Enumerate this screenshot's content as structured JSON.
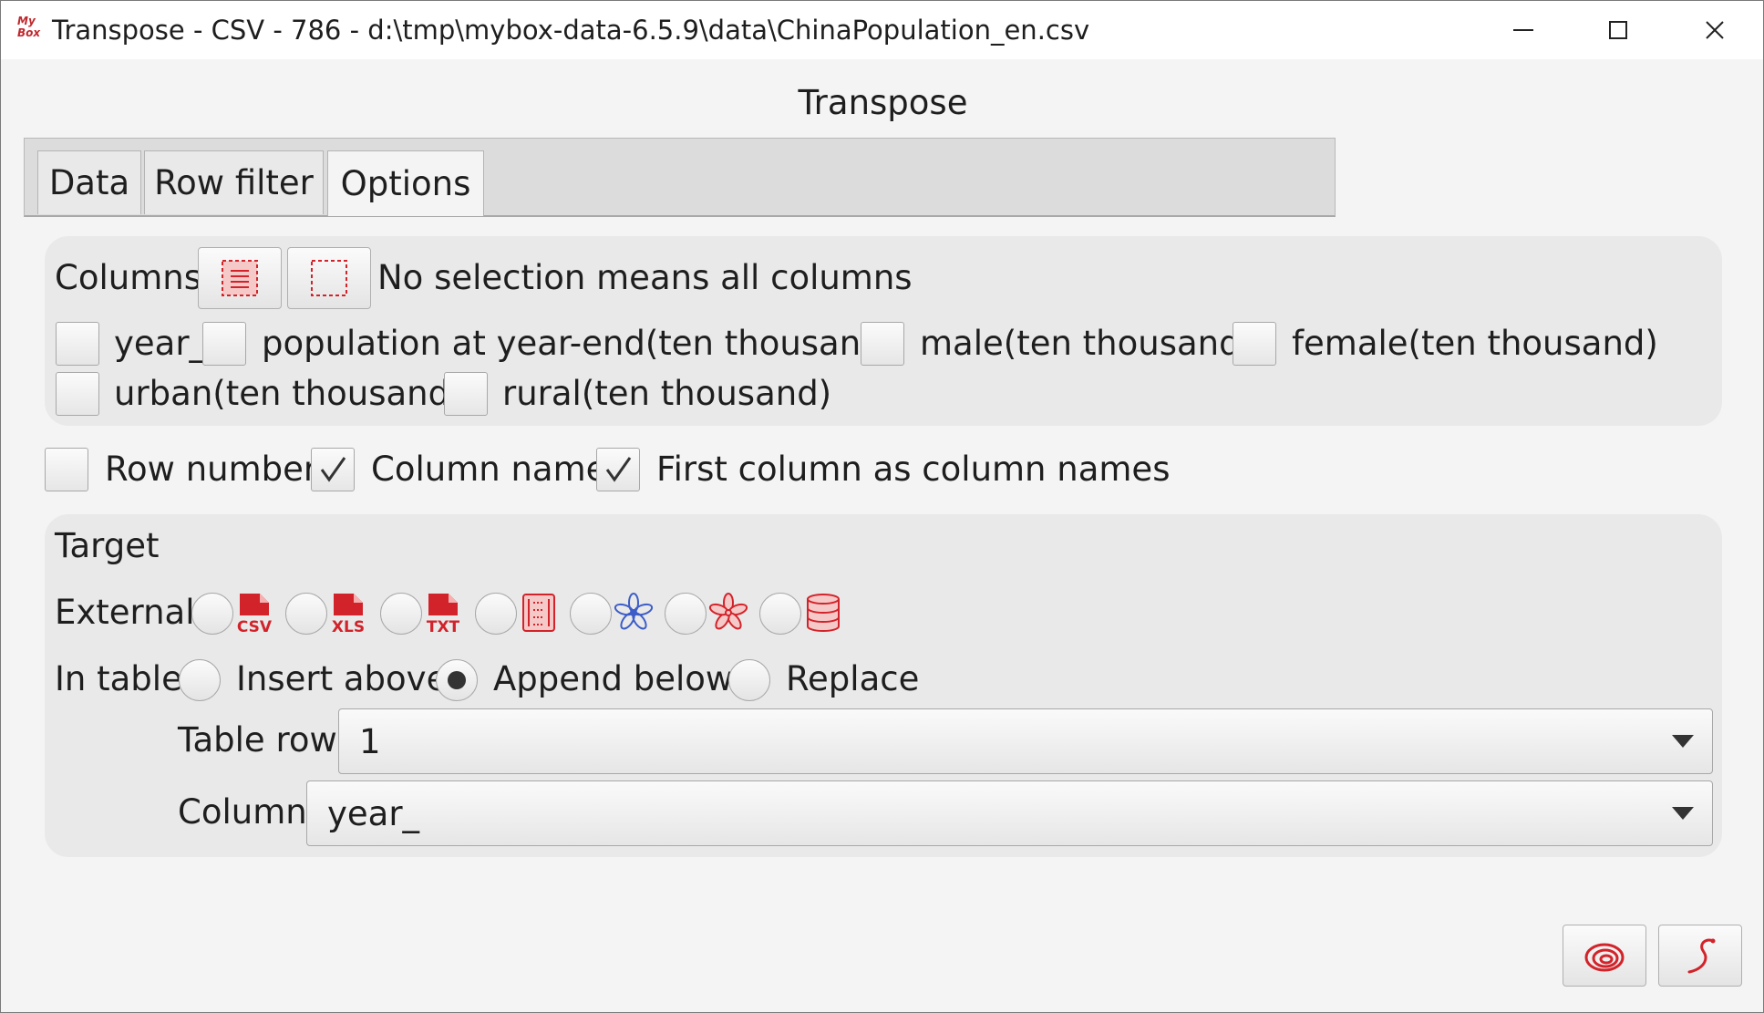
{
  "window": {
    "title": "Transpose - CSV - 786 - d:\\tmp\\mybox-data-6.5.9\\data\\ChinaPopulation_en.csv",
    "app_logo_top": "My",
    "app_logo_bottom": "Box"
  },
  "header": {
    "title": "Transpose"
  },
  "tabs": [
    {
      "label": "Data",
      "active": false
    },
    {
      "label": "Row filter",
      "active": false
    },
    {
      "label": "Options",
      "active": true
    }
  ],
  "columns_panel": {
    "label": "Columns",
    "hint": "No selection means all columns",
    "columns": [
      {
        "label": "year_",
        "checked": false
      },
      {
        "label": "population at year-end(ten thousand)",
        "checked": false
      },
      {
        "label": "male(ten thousand)",
        "checked": false
      },
      {
        "label": "female(ten thousand)",
        "checked": false
      },
      {
        "label": "urban(ten thousand)",
        "checked": false
      },
      {
        "label": "rural(ten thousand)",
        "checked": false
      }
    ]
  },
  "options": {
    "row_number": {
      "label": "Row number",
      "checked": false
    },
    "column_name": {
      "label": "Column name",
      "checked": true
    },
    "first_column_names": {
      "label": "First column as column names",
      "checked": true
    }
  },
  "target": {
    "title": "Target",
    "external_label": "External",
    "external_formats": [
      {
        "icon": "csv-file-icon",
        "text": "CSV"
      },
      {
        "icon": "xls-file-icon",
        "text": "XLS"
      },
      {
        "icon": "txt-file-icon",
        "text": "TXT"
      },
      {
        "icon": "matrix-icon",
        "text": ""
      },
      {
        "icon": "system-clipboard-icon",
        "text": ""
      },
      {
        "icon": "mybox-clipboard-icon",
        "text": ""
      },
      {
        "icon": "database-table-icon",
        "text": ""
      }
    ],
    "in_table_label": "In table",
    "in_table_options": [
      {
        "label": "Insert above",
        "selected": false
      },
      {
        "label": "Append below",
        "selected": true
      },
      {
        "label": "Replace",
        "selected": false
      }
    ],
    "table_row_label": "Table row",
    "table_row_value": "1",
    "column_label": "Column",
    "column_value": "year_"
  },
  "colors": {
    "accent_red": "#d2232a",
    "accent_blue": "#3c5dc8"
  }
}
